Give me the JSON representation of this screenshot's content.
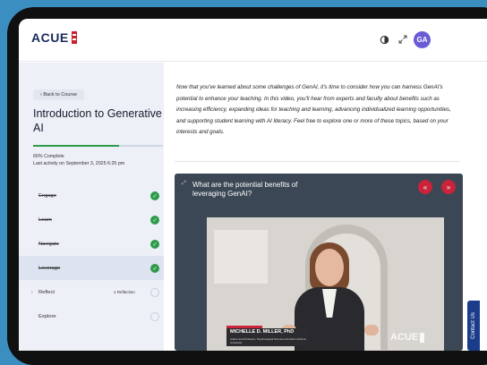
{
  "brand": {
    "name": "ACUE"
  },
  "header": {
    "avatar_initials": "GA"
  },
  "sidebar": {
    "back_label": "‹  Back to Course",
    "course_title": "Introduction to Generative AI",
    "progress_fraction": 0.66,
    "progress_text": "66% Complete",
    "last_activity": "Last activity on September 3, 2025 6:25 pm",
    "items": [
      {
        "label": "Engage",
        "status": "done"
      },
      {
        "label": "Learn",
        "status": "done"
      },
      {
        "label": "Navigate",
        "status": "done"
      },
      {
        "label": "Leverage",
        "status": "done"
      },
      {
        "label": "Reflect",
        "status": "open",
        "count": "1 Reflection"
      },
      {
        "label": "Explore",
        "status": "open"
      }
    ]
  },
  "main": {
    "intro": "Now that you've learned about some challenges of GenAI, it's time to consider how you can harness GenAI's potential to enhance your teaching. In this video, you'll hear from experts and faculty about benefits such as increasing efficiency, expanding ideas for teaching and learning, advancing individualized learning opportunities, and supporting student learning with AI literacy. Feel free to explore one or more of these topics, based on your interests and goals.",
    "video_card": {
      "title": "What are the potential benefits of leveraging GenAI?",
      "lower_third_name": "MICHELLE D. MILLER, PhD",
      "lower_third_sub": "Author and Professor, Psychological Sciences Northern Arizona University",
      "watermark": "ACUE"
    }
  },
  "contact_label": "Contact Us",
  "colors": {
    "brand_navy": "#1a2b5a",
    "brand_red": "#c9243a",
    "success_green": "#2e9b4a",
    "avatar_purple": "#6a5cd6"
  }
}
